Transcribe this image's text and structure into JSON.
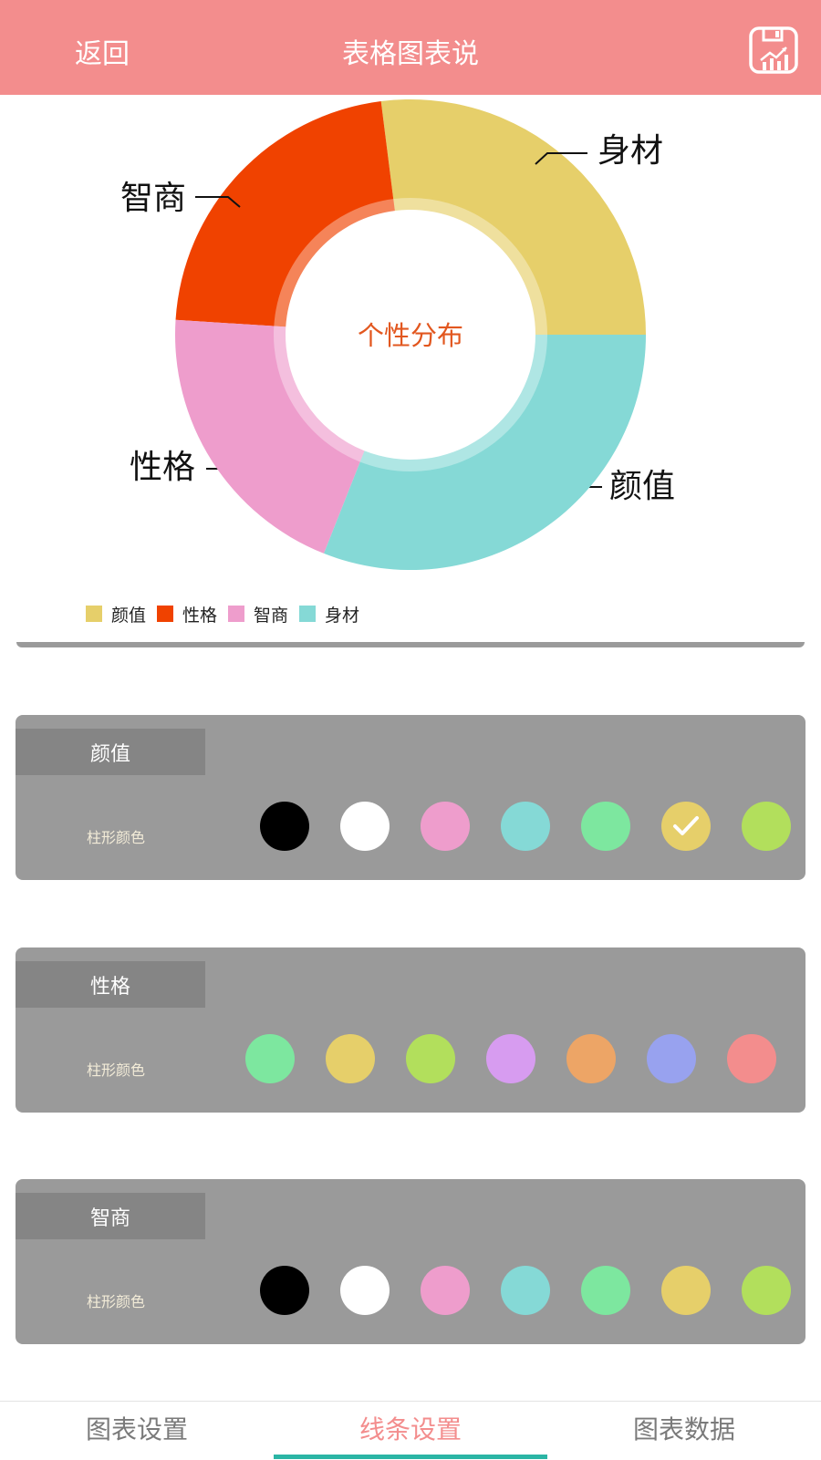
{
  "header": {
    "back_label": "返回",
    "title": "表格图表说"
  },
  "chart_data": {
    "type": "pie",
    "center_label": "个性分布",
    "categories": [
      "颜值",
      "性格",
      "智商",
      "身材"
    ],
    "values": [
      27,
      22,
      20,
      31
    ],
    "colors": [
      "#e6cf6a",
      "#f04200",
      "#ee9dcc",
      "#85d9d6"
    ],
    "legend": {
      "placement": "bottom-left"
    }
  },
  "panels": [
    {
      "title": "颜值",
      "subtitle": "柱形颜色",
      "swatches": [
        {
          "color": "#000000",
          "selected": false
        },
        {
          "color": "#ffffff",
          "selected": false
        },
        {
          "color": "#ee9dcc",
          "selected": false
        },
        {
          "color": "#85d9d6",
          "selected": false
        },
        {
          "color": "#7de79f",
          "selected": false
        },
        {
          "color": "#e6cf6a",
          "selected": true
        },
        {
          "color": "#b2df5c",
          "selected": false
        }
      ]
    },
    {
      "title": "性格",
      "subtitle": "柱形颜色",
      "swatches": [
        {
          "color": "#7de79f",
          "selected": false
        },
        {
          "color": "#e6cf6a",
          "selected": false
        },
        {
          "color": "#b2df5c",
          "selected": false
        },
        {
          "color": "#d79cf0",
          "selected": false
        },
        {
          "color": "#eda566",
          "selected": false
        },
        {
          "color": "#98a2ef",
          "selected": false
        },
        {
          "color": "#f38d8d",
          "selected": false
        },
        {
          "color": "#f04200",
          "selected": true
        }
      ]
    },
    {
      "title": "智商",
      "subtitle": "柱形颜色",
      "swatches": [
        {
          "color": "#000000",
          "selected": false
        },
        {
          "color": "#ffffff",
          "selected": false
        },
        {
          "color": "#ee9dcc",
          "selected": false
        },
        {
          "color": "#85d9d6",
          "selected": false
        },
        {
          "color": "#7de79f",
          "selected": false
        },
        {
          "color": "#e6cf6a",
          "selected": false
        },
        {
          "color": "#b2df5c",
          "selected": false
        }
      ]
    }
  ],
  "bottom_tabs": [
    {
      "label": "图表设置",
      "active": false
    },
    {
      "label": "线条设置",
      "active": true
    },
    {
      "label": "图表数据",
      "active": false
    }
  ],
  "theme": {
    "header_color": "#f38d8d",
    "active_tab_color": "#f38d8d",
    "tab_indicator_color": "#2bb5a5",
    "panel_color": "#9a9a9a"
  }
}
